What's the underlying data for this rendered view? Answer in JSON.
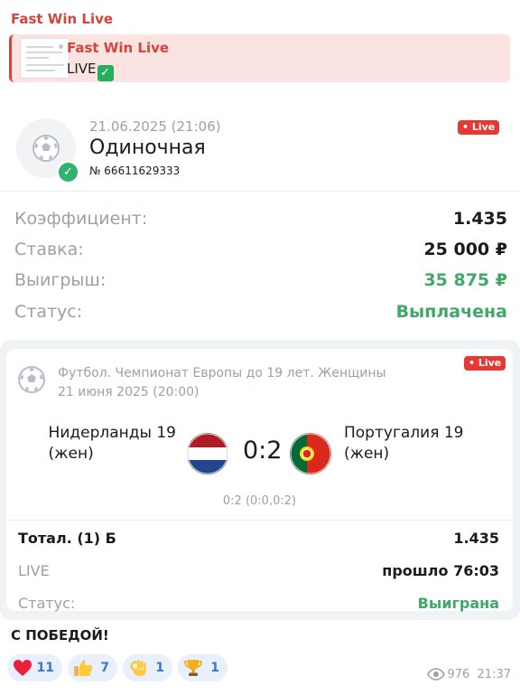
{
  "message": {
    "sender": "Fast Win Live",
    "caption": "С ПОБЕДОЙ!",
    "views": "976",
    "time": "21:37"
  },
  "reply": {
    "title": "Fast Win Live",
    "text": "LIVE"
  },
  "bet": {
    "date": "21.06.2025 (21:06)",
    "type": "Одиночная",
    "number": "№ 66611629333",
    "badge": "• Live",
    "rows": [
      {
        "label": "Коэффициент:",
        "value": "1.435"
      },
      {
        "label": "Ставка:",
        "value": "25 000 ₽"
      },
      {
        "label": "Выигрыш:",
        "value": "35 875 ₽"
      },
      {
        "label": "Статус:",
        "value": "Выплачена"
      }
    ]
  },
  "match": {
    "league": "Футбол. Чемпионат Европы до 19 лет. Женщины",
    "date": "21 июня 2025 (20:00)",
    "badge": "• Live",
    "home_line1": "Нидерланды 19",
    "home_line2": "(жен)",
    "away_line1": "Португалия 19",
    "away_line2": "(жен)",
    "score": "0:2",
    "score_detail": "0:2 (0:0,0:2)",
    "rows": [
      {
        "label": "Тотал. (1) Б",
        "value": "1.435"
      },
      {
        "label": "LIVE",
        "value": "прошло 76:03"
      },
      {
        "label": "Статус:",
        "value": "Выиграна"
      }
    ]
  },
  "reactions": [
    {
      "icon": "heart-icon",
      "count": "11"
    },
    {
      "icon": "thumbs-up-icon",
      "count": "7"
    },
    {
      "icon": "ok-hand-icon",
      "count": "1"
    },
    {
      "icon": "trophy-icon",
      "count": "1"
    }
  ],
  "colors": {
    "brand": "#d6433a",
    "live": "#e53935",
    "success": "#3fa968",
    "muted": "#9aa1a9",
    "reaction_bg": "#e8f0fb",
    "reaction_text": "#3a78c6"
  }
}
